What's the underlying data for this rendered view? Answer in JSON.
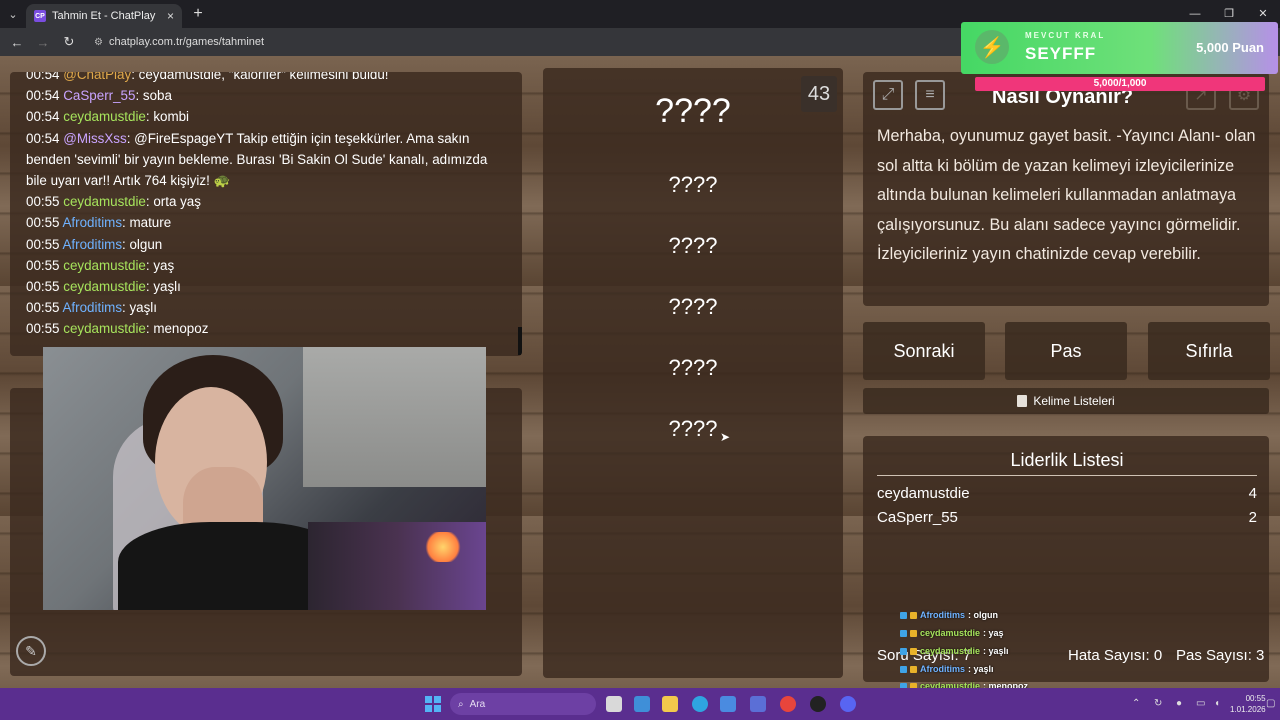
{
  "browser": {
    "tab_title": "Tahmin Et - ChatPlay",
    "favicon": "CP",
    "url": "chatplay.com.tr/games/tahminet",
    "new_tab": "+",
    "close": "×"
  },
  "chat": {
    "messages": [
      {
        "time": "00:54",
        "user": "@ChatPlay",
        "color": "#e0a94b",
        "text": ": ceydamustdie, \"kalorifer\" kelimesini buldu!"
      },
      {
        "time": "00:54",
        "user": "CaSperr_55",
        "color": "#c9a4ff",
        "text": ": soba"
      },
      {
        "time": "00:54",
        "user": "ceydamustdie",
        "color": "#a6e35c",
        "text": ": kombi"
      },
      {
        "time": "00:54",
        "user": "@MissXss",
        "color": "#c9a4ff",
        "text": ": @FireEspageYT Takip ettiğin için teşekkürler. Ama sakın benden 'sevimli' bir yayın bekleme. Burası 'Bi Sakin Ol Sude' kanalı, adımızda bile uyarı var!! Artık 764 kişiyiz! 🐢"
      },
      {
        "time": "00:55",
        "user": "ceydamustdie",
        "color": "#a6e35c",
        "text": ": orta yaş"
      },
      {
        "time": "00:55",
        "user": "Afroditims",
        "color": "#6fb2ff",
        "text": ": mature"
      },
      {
        "time": "00:55",
        "user": "Afroditims",
        "color": "#6fb2ff",
        "text": ": olgun"
      },
      {
        "time": "00:55",
        "user": "ceydamustdie",
        "color": "#a6e35c",
        "text": ": yaş"
      },
      {
        "time": "00:55",
        "user": "ceydamustdie",
        "color": "#a6e35c",
        "text": ": yaşlı"
      },
      {
        "time": "00:55",
        "user": "Afroditims",
        "color": "#6fb2ff",
        "text": ": yaşlı"
      },
      {
        "time": "00:55",
        "user": "ceydamustdie",
        "color": "#a6e35c",
        "text": ": menopoz"
      }
    ]
  },
  "game": {
    "timer": "43",
    "main_word": "????",
    "words": [
      "????",
      "????",
      "????",
      "????",
      "????"
    ]
  },
  "howto": {
    "title": "Nasıl Oynanır?",
    "text": "Merhaba, oyunumuz gayet basit. -Yayıncı Alanı- olan sol altta ki bölüm de yazan kelimeyi izleyicilerinize altında bulunan kelimeleri kullanmadan anlatmaya çalışıyorsunuz. Bu alanı sadece yayıncı görmelidir. İzleyicileriniz yayın chatinizde cevap verebilir."
  },
  "buttons": {
    "next": "Sonraki",
    "pass": "Pas",
    "reset": "Sıfırla",
    "word_lists": "Kelime Listeleri"
  },
  "leaderboard": {
    "title": "Liderlik Listesi",
    "rows": [
      {
        "name": "ceydamustdie",
        "score": "4"
      },
      {
        "name": "CaSperr_55",
        "score": "2"
      }
    ]
  },
  "stats": {
    "question_count": "Soru Sayısı: 7",
    "error_count": "Hata Sayısı: 0",
    "pass_count": "Pas Sayısı: 3"
  },
  "overlay_chat": [
    {
      "user": "Afroditims",
      "color": "#6fb2ff",
      "text": ": olgun"
    },
    {
      "user": "ceydamustdie",
      "color": "#a6e35c",
      "text": ": yaş"
    },
    {
      "user": "ceydamustdie",
      "color": "#a6e35c",
      "text": ": yaşlı"
    },
    {
      "user": "Afroditims",
      "color": "#6fb2ff",
      "text": ": yaşlı"
    },
    {
      "user": "ceydamustdie",
      "color": "#a6e35c",
      "text": ": menopoz"
    }
  ],
  "king_overlay": {
    "label": "MEVCUT KRAL",
    "name": "SEYFFF",
    "points": "5,000 Puan",
    "progress": "5,000/1,000"
  },
  "taskbar": {
    "search_placeholder": "Ara",
    "time": "00:55",
    "date": "1.01.2026"
  }
}
